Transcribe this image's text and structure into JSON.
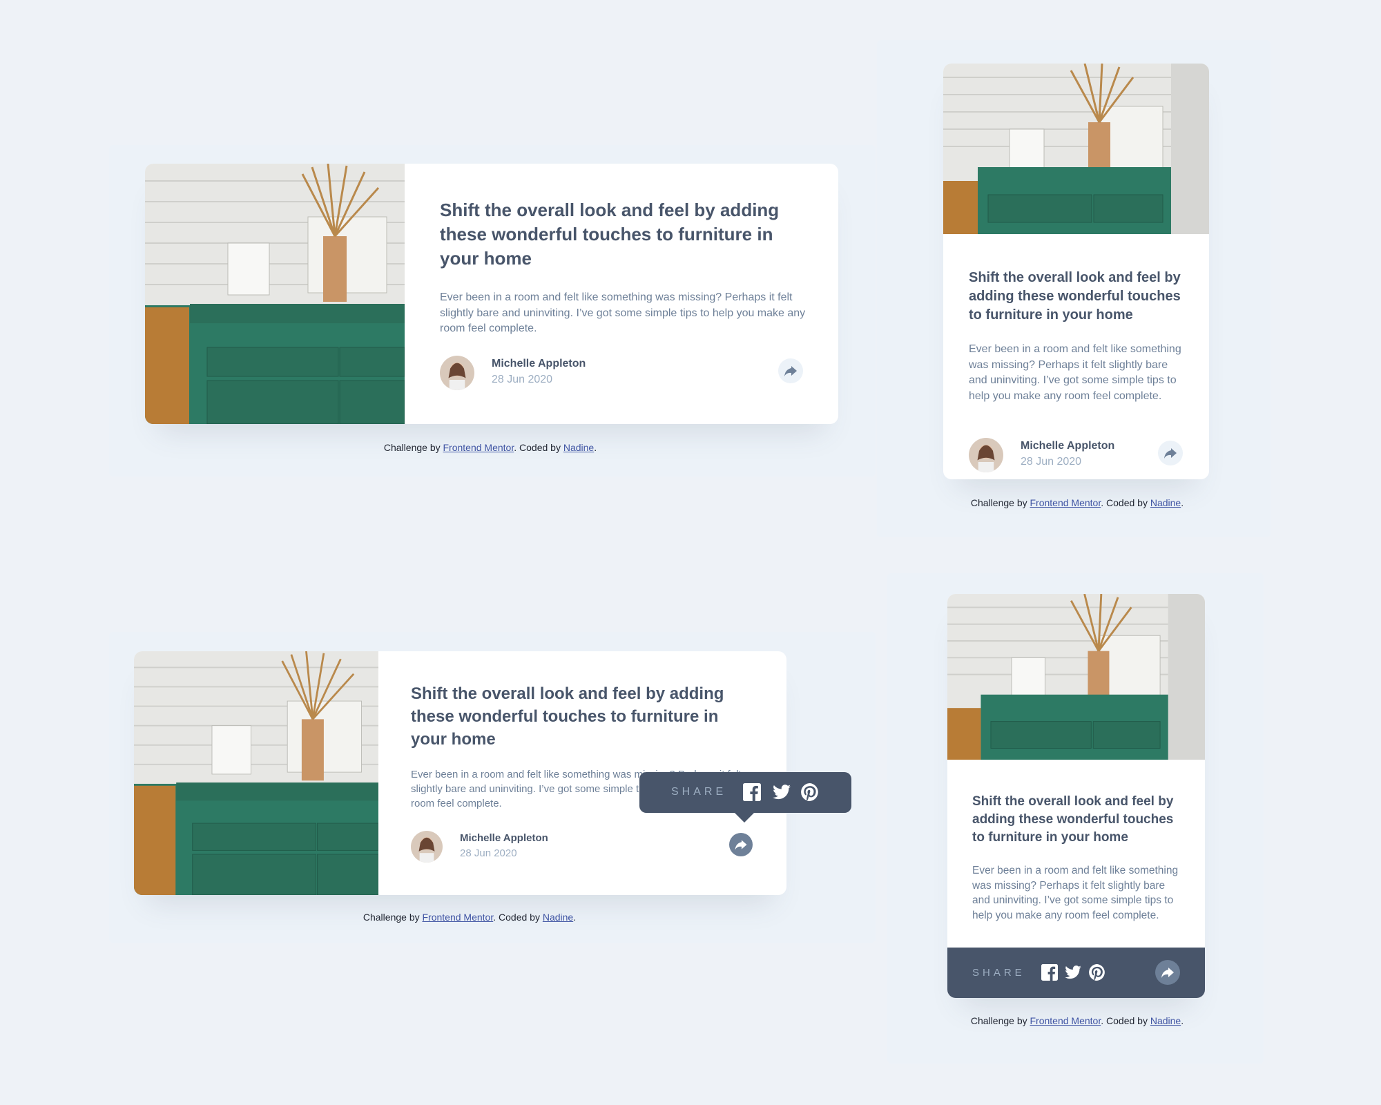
{
  "colors": {
    "background": "#eef2f7",
    "card": "#ffffff",
    "heading": "#48556a",
    "body_text": "#6e8098",
    "muted": "#9daec2",
    "share_bg": "#ecf2f8",
    "popover": "#48556a",
    "link": "#3f54a3"
  },
  "article": {
    "title": "Shift the overall look and feel by adding these wonderful touches to furniture in your home",
    "excerpt": "Ever been in a room and felt like something was missing? Perhaps it felt slightly bare and uninviting. I’ve got some simple tips to help you make any room feel complete.",
    "author": "Michelle Appleton",
    "date": "28 Jun 2020"
  },
  "share": {
    "label": "SHARE",
    "icons": [
      "facebook-icon",
      "twitter-icon",
      "pinterest-icon",
      "share-arrow-icon"
    ]
  },
  "attribution": {
    "prefix": "Challenge by ",
    "link1": "Frontend Mentor",
    "middle": ". Coded by ",
    "link2": "Nadine",
    "suffix": "."
  }
}
